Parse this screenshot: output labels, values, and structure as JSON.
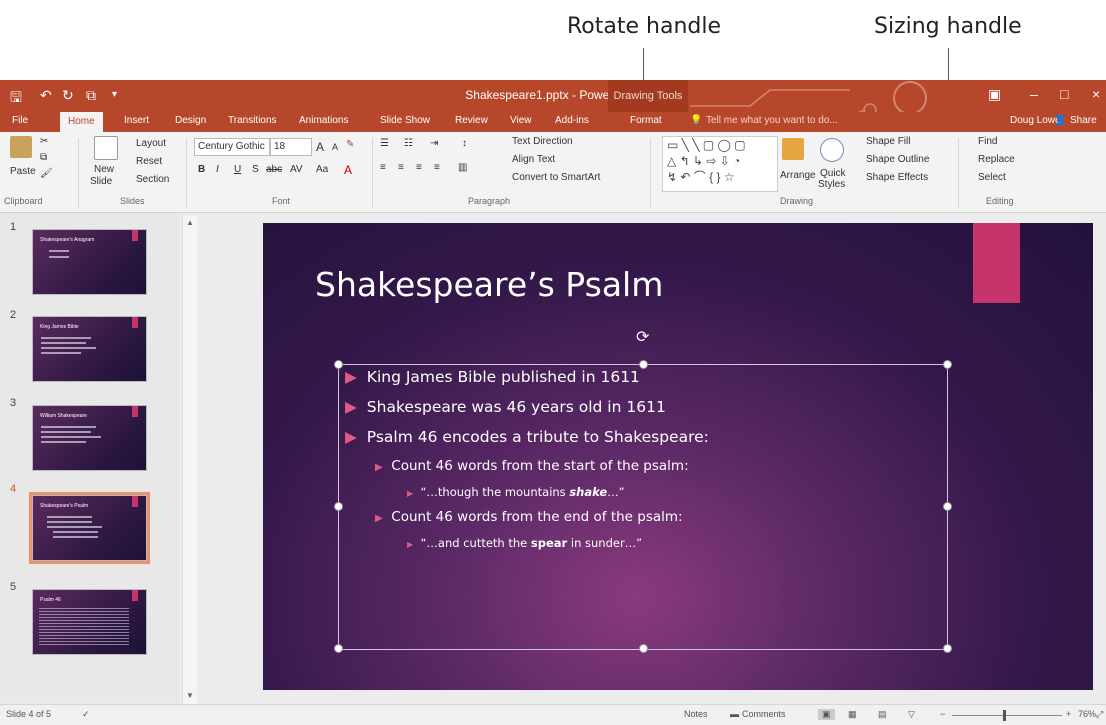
{
  "callouts": {
    "rotate": "Rotate handle",
    "sizing": "Sizing handle"
  },
  "window": {
    "title": "Shakespeare1.pptx - PowerPoint",
    "context_tab": "Drawing Tools",
    "controls": {
      "minimize": "–",
      "restore": "□",
      "close": "×",
      "ribbon_options": "▣"
    }
  },
  "tabs": [
    {
      "label": "File"
    },
    {
      "label": "Home"
    },
    {
      "label": "Insert"
    },
    {
      "label": "Design"
    },
    {
      "label": "Transitions"
    },
    {
      "label": "Animations"
    },
    {
      "label": "Slide Show"
    },
    {
      "label": "Review"
    },
    {
      "label": "View"
    },
    {
      "label": "Add-ins"
    },
    {
      "label": "Format"
    }
  ],
  "tell_me": "Tell me what you want to do...",
  "user": {
    "name": "Doug Lowe",
    "share": "Share"
  },
  "ribbon": {
    "clipboard": {
      "paste": "Paste",
      "group": "Clipboard"
    },
    "slides": {
      "new_slide": "New",
      "new_slide2": "Slide",
      "layout": "Layout",
      "reset": "Reset",
      "section": "Section",
      "group": "Slides"
    },
    "font": {
      "family": "Century Gothic",
      "size": "18",
      "group": "Font",
      "bold": "B",
      "italic": "I",
      "underline": "U",
      "shadow": "S",
      "strike": "abc",
      "spacing": "AV",
      "case": "Aa",
      "color": "A",
      "grow": "A",
      "shrink": "A"
    },
    "paragraph": {
      "text_direction": "Text Direction",
      "align_text": "Align Text",
      "convert": "Convert to SmartArt",
      "group": "Paragraph"
    },
    "drawing": {
      "arrange": "Arrange",
      "quick_styles": "Quick",
      "quick_styles2": "Styles",
      "shape_fill": "Shape Fill",
      "shape_outline": "Shape Outline",
      "shape_effects": "Shape Effects",
      "group": "Drawing"
    },
    "editing": {
      "find": "Find",
      "replace": "Replace",
      "select": "Select",
      "group": "Editing"
    }
  },
  "thumbnails": [
    {
      "num": "1",
      "title": "Shakespeare's Anagram",
      "selected": false
    },
    {
      "num": "2",
      "title": "King James Bible",
      "selected": false
    },
    {
      "num": "3",
      "title": "William Shakespeare",
      "selected": false
    },
    {
      "num": "4",
      "title": "Shakespeare's Psalm",
      "selected": true
    },
    {
      "num": "5",
      "title": "Psalm 46",
      "selected": false
    }
  ],
  "slide": {
    "title": "Shakespeare’s Psalm",
    "bullets": [
      {
        "level": 1,
        "text": "King James Bible published in 1611"
      },
      {
        "level": 1,
        "text": "Shakespeare was 46 years old in 1611"
      },
      {
        "level": 1,
        "text": "Psalm 46 encodes a tribute to Shakespeare:"
      },
      {
        "level": 2,
        "text": "Count 46 words from the start of the psalm:"
      },
      {
        "level": 3,
        "pre": "“…though the mountains ",
        "bold": "shake",
        "post": "…”"
      },
      {
        "level": 2,
        "text": "Count 46 words from the end of the psalm:"
      },
      {
        "level": 3,
        "pre": "“…and cutteth the ",
        "bold": "spear",
        "post": " in sunder…”"
      }
    ]
  },
  "status": {
    "slide_of": "Slide 4 of 5",
    "notes": "Notes",
    "comments": "Comments",
    "zoom": "76%"
  },
  "colors": {
    "accent": "#b7472a",
    "slide_pink": "#c7336b",
    "bullet_arrow": "#e05a87"
  }
}
